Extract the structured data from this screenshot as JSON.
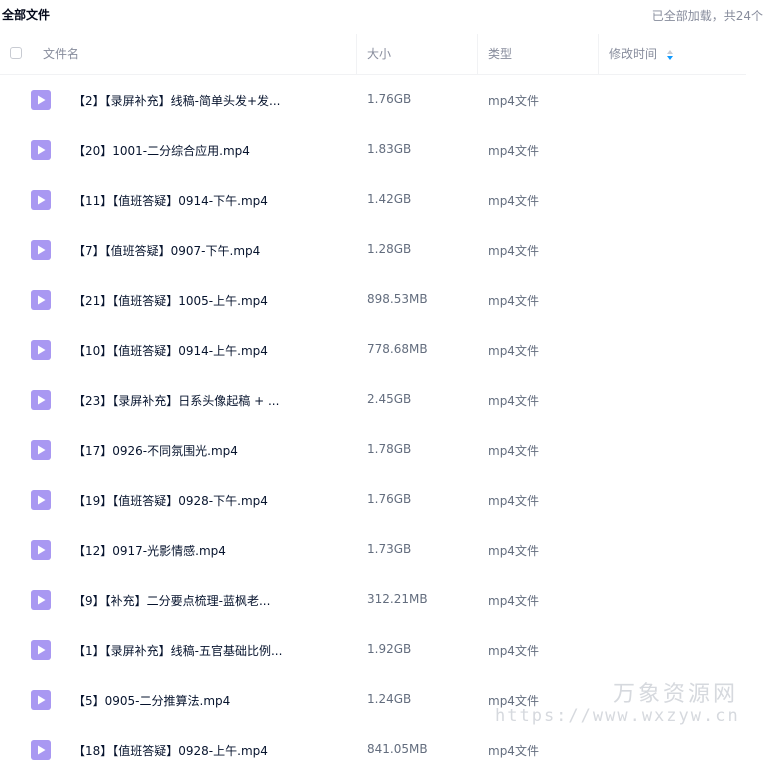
{
  "breadcrumb": "全部文件",
  "load_status": "已全部加载，共24个",
  "columns": {
    "name": "文件名",
    "size": "大小",
    "type": "类型",
    "modified": "修改时间"
  },
  "accent_color": "#0d99ff",
  "file_icon": "video-file-icon",
  "files": [
    {
      "name": "【2】【录屏补充】线稿-简单头发+发...",
      "size": "1.76GB",
      "type": "mp4文件"
    },
    {
      "name": "【20】1001-二分综合应用.mp4",
      "size": "1.83GB",
      "type": "mp4文件"
    },
    {
      "name": "【11】【值班答疑】0914-下午.mp4",
      "size": "1.42GB",
      "type": "mp4文件"
    },
    {
      "name": "【7】【值班答疑】0907-下午.mp4",
      "size": "1.28GB",
      "type": "mp4文件"
    },
    {
      "name": "【21】【值班答疑】1005-上午.mp4",
      "size": "898.53MB",
      "type": "mp4文件"
    },
    {
      "name": "【10】【值班答疑】0914-上午.mp4",
      "size": "778.68MB",
      "type": "mp4文件"
    },
    {
      "name": "【23】【录屏补充】日系头像起稿 + ...",
      "size": "2.45GB",
      "type": "mp4文件"
    },
    {
      "name": "【17】0926-不同氛围光.mp4",
      "size": "1.78GB",
      "type": "mp4文件"
    },
    {
      "name": "【19】【值班答疑】0928-下午.mp4",
      "size": "1.76GB",
      "type": "mp4文件"
    },
    {
      "name": "【12】0917-光影情感.mp4",
      "size": "1.73GB",
      "type": "mp4文件"
    },
    {
      "name": "【9】【补充】二分要点梳理-蓝枫老...",
      "size": "312.21MB",
      "type": "mp4文件"
    },
    {
      "name": "【1】【录屏补充】线稿-五官基础比例...",
      "size": "1.92GB",
      "type": "mp4文件"
    },
    {
      "name": "【5】0905-二分推算法.mp4",
      "size": "1.24GB",
      "type": "mp4文件"
    },
    {
      "name": "【18】【值班答疑】0928-上午.mp4",
      "size": "841.05MB",
      "type": "mp4文件"
    }
  ],
  "watermark": {
    "line1": "万象资源网",
    "line2": "https://www.wxzyw.cn"
  }
}
